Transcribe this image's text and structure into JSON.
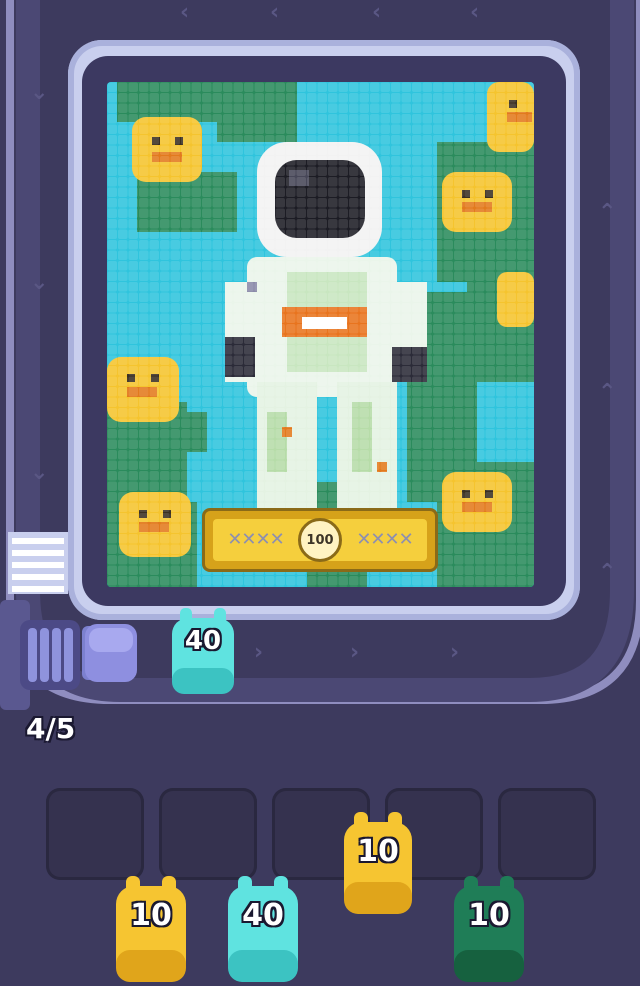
{
  "board": {
    "progress_badge": "100",
    "chain_left": "✕✕✕✕",
    "chain_right": "✕✕✕✕"
  },
  "shooter": {
    "ammo_counter": "4/5"
  },
  "active_piece": {
    "value": "40",
    "color": "#5fe3e0"
  },
  "slots": [
    {
      "id": "slot-1"
    },
    {
      "id": "slot-2"
    },
    {
      "id": "slot-3"
    },
    {
      "id": "slot-4"
    },
    {
      "id": "slot-5"
    }
  ],
  "queue": [
    {
      "value": "10",
      "color": "#f6c531"
    },
    {
      "value": "40",
      "color": "#5fe3e0"
    },
    {
      "value": "10",
      "color": "#f6c531"
    },
    {
      "value": "10",
      "color": "#1f7d57"
    }
  ],
  "colors": {
    "background": "#3d3a5e",
    "sky": "#2fc4dd",
    "leaf": "#2a8b5c",
    "flower": "#f5c42e",
    "suit": "#e8f4ea"
  }
}
